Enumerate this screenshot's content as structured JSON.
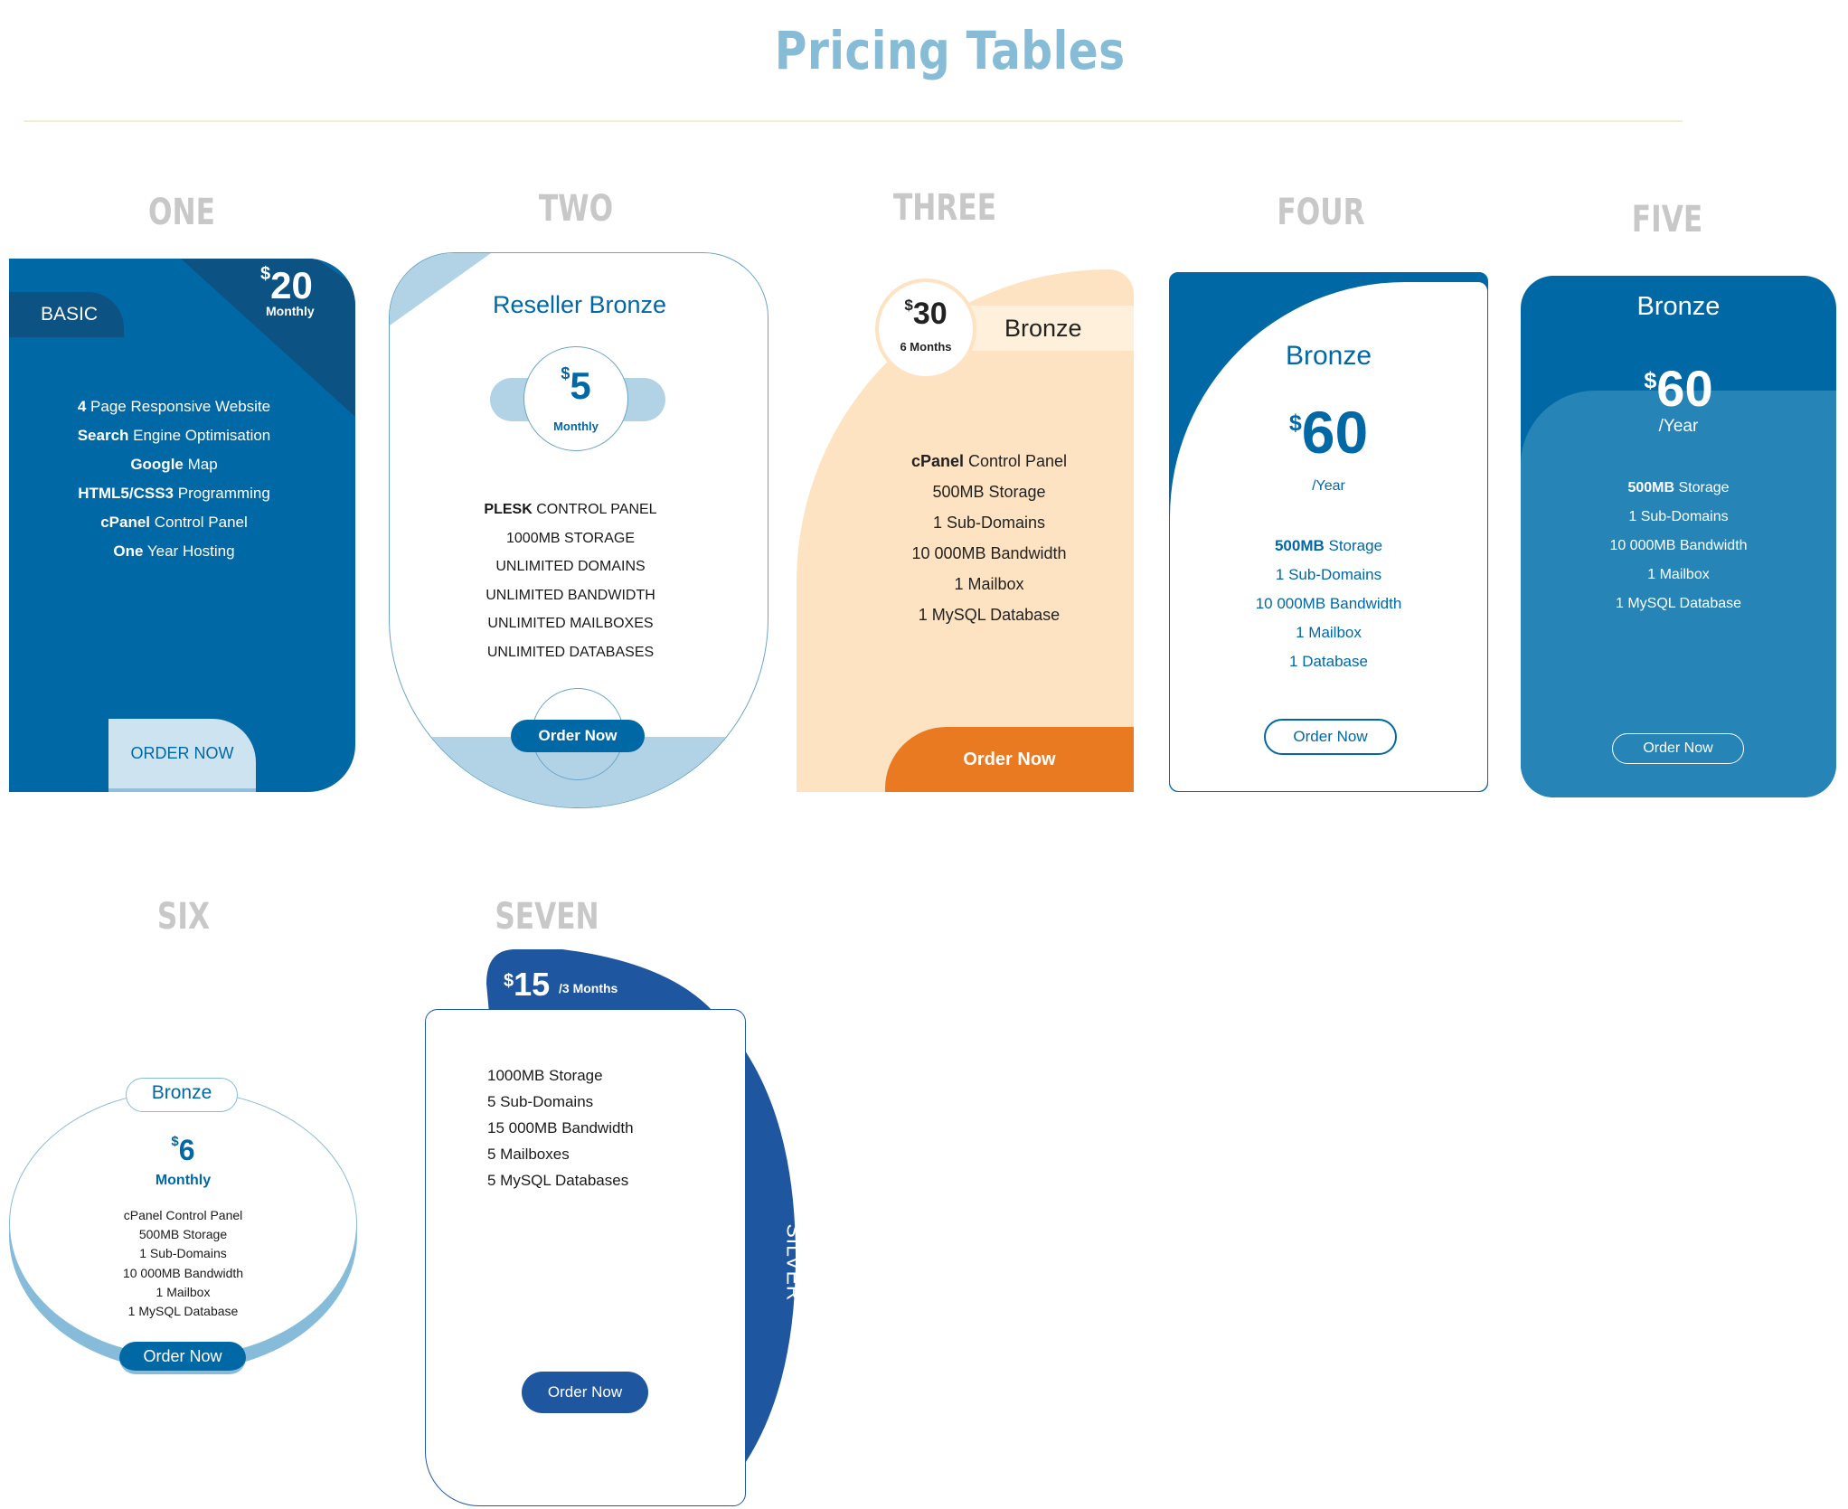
{
  "page": {
    "title": "Pricing Tables"
  },
  "labels": [
    "ONE",
    "TWO",
    "THREE",
    "FOUR",
    "FIVE",
    "SIX",
    "SEVEN"
  ],
  "colors": {
    "primary": "#0068a5",
    "dark": "#0c5283",
    "light": "#b2d3e6",
    "peach": "#fde3c2",
    "orange": "#e97a22",
    "navy": "#1e56a0",
    "gray_label": "#c8c8c8"
  },
  "card1": {
    "plan": "BASIC",
    "currency": "$",
    "amount": "20",
    "period": "Monthly",
    "features": [
      {
        "bold": "4",
        "text": " Page Responsive Website"
      },
      {
        "bold": "Search",
        "text": " Engine Optimisation"
      },
      {
        "bold": "Google",
        "text": " Map"
      },
      {
        "bold": "HTML5/CSS3",
        "text": " Programming"
      },
      {
        "bold": "cPanel",
        "text": " Control Panel"
      },
      {
        "bold": "One",
        "text": " Year Hosting"
      }
    ],
    "button": "ORDER NOW"
  },
  "card2": {
    "plan": "Reseller Bronze",
    "currency": "$",
    "amount": "5",
    "period": "Monthly",
    "features": [
      {
        "bold": "PLESK",
        "text": " CONTROL PANEL"
      },
      {
        "bold": "",
        "text": "1000MB STORAGE"
      },
      {
        "bold": "",
        "text": "UNLIMITED DOMAINS"
      },
      {
        "bold": "",
        "text": "UNLIMITED BANDWIDTH"
      },
      {
        "bold": "",
        "text": "UNLIMITED MAILBOXES"
      },
      {
        "bold": "",
        "text": "UNLIMITED DATABASES"
      }
    ],
    "button": "Order Now"
  },
  "card3": {
    "plan": "Bronze",
    "currency": "$",
    "amount": "30",
    "period": "6 Months",
    "features": [
      {
        "bold": "cPanel",
        "text": " Control Panel"
      },
      {
        "bold": "",
        "text": "500MB Storage"
      },
      {
        "bold": "",
        "text": "1 Sub-Domains"
      },
      {
        "bold": "",
        "text": "10 000MB Bandwidth"
      },
      {
        "bold": "",
        "text": "1 Mailbox"
      },
      {
        "bold": "",
        "text": "1 MySQL Database"
      }
    ],
    "button": "Order Now"
  },
  "card4": {
    "plan": "Bronze",
    "currency": "$",
    "amount": "60",
    "period": "/Year",
    "features": [
      {
        "bold": "500MB",
        "text": " Storage"
      },
      {
        "bold": "",
        "text": "1 Sub-Domains"
      },
      {
        "bold": "",
        "text": "10 000MB Bandwidth"
      },
      {
        "bold": "",
        "text": "1 Mailbox"
      },
      {
        "bold": "",
        "text": "1 Database"
      }
    ],
    "button": "Order Now"
  },
  "card5": {
    "plan": "Bronze",
    "currency": "$",
    "amount": "60",
    "period": "/Year",
    "features": [
      {
        "bold": "500MB",
        "text": " Storage"
      },
      {
        "bold": "",
        "text": "1 Sub-Domains"
      },
      {
        "bold": "",
        "text": "10 000MB Bandwidth"
      },
      {
        "bold": "",
        "text": "1 Mailbox"
      },
      {
        "bold": "",
        "text": "1 MySQL Database"
      }
    ],
    "button": "Order Now"
  },
  "card6": {
    "plan": "Bronze",
    "currency": "$",
    "amount": "6",
    "period": "Monthly",
    "features": [
      {
        "bold": "",
        "text": "cPanel Control Panel"
      },
      {
        "bold": "",
        "text": "500MB Storage"
      },
      {
        "bold": "",
        "text": "1 Sub-Domains"
      },
      {
        "bold": "",
        "text": "10 000MB Bandwidth"
      },
      {
        "bold": "",
        "text": "1 Mailbox"
      },
      {
        "bold": "",
        "text": "1 MySQL Database"
      }
    ],
    "button": "Order Now"
  },
  "card7": {
    "plan": "SILVER",
    "currency": "$",
    "amount": "15",
    "period": "/3 Months",
    "features": [
      {
        "bold": "",
        "text": "1000MB Storage"
      },
      {
        "bold": "",
        "text": "5 Sub-Domains"
      },
      {
        "bold": "",
        "text": "15 000MB Bandwidth"
      },
      {
        "bold": "",
        "text": "5 Mailboxes"
      },
      {
        "bold": "",
        "text": "5 MySQL Databases"
      }
    ],
    "button": "Order Now"
  }
}
